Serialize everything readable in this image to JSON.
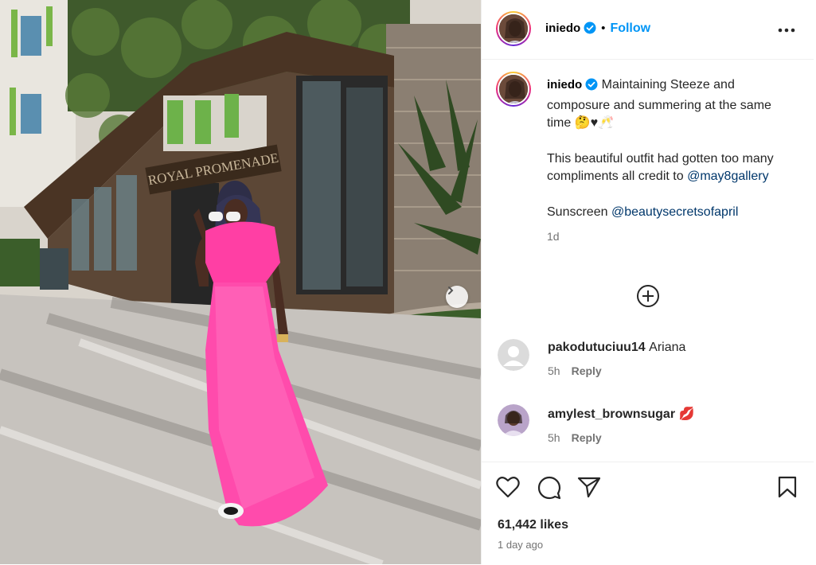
{
  "post": {
    "username": "iniedo",
    "follow_label": "Follow",
    "separator": "•"
  },
  "caption": {
    "line1": "Maintaining Steeze and composure and summering at the same time 🤔♥🥂",
    "line2": "This beautiful outfit had gotten too many compliments all credit to",
    "mention1": "@may8gallery",
    "line3_prefix": "Sunscreen",
    "mention2": "@beautysecretsofapril",
    "time": "1d"
  },
  "comments": [
    {
      "username": "pakodutuciuu14",
      "text": "Ariana",
      "time": "5h",
      "reply_label": "Reply"
    },
    {
      "username": "amylest_brownsugar",
      "text": "💋",
      "time": "5h",
      "reply_label": "Reply"
    }
  ],
  "footer": {
    "likes": "61,442 likes",
    "posted": "1 day ago"
  },
  "photo": {
    "sign_text": "ROYAL PROMENADE"
  },
  "icons": {
    "verified": "verified-badge-icon",
    "more": "more-options-icon",
    "add_comment": "plus-circle-icon",
    "like": "heart-icon",
    "comment": "comment-bubble-icon",
    "share": "paper-plane-icon",
    "save": "bookmark-icon",
    "next": "chevron-right-icon"
  },
  "colors": {
    "link": "#0095f6",
    "mention": "#00376b",
    "muted": "#737373",
    "dress": "#ff3fa4"
  }
}
